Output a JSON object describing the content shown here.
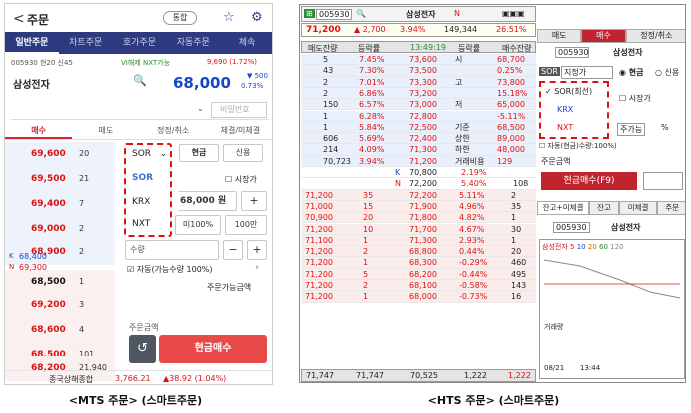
{
  "mts": {
    "back_glyph": "<",
    "title": "주문",
    "toggle_label": "통합",
    "tabs": [
      "일반주문",
      "차트주문",
      "호가주문",
      "자동주문",
      "체속"
    ],
    "info_left": "005930 현20 신45",
    "info_mid": "VI해제 NXT가능",
    "info_right": "9,690 (1.72%)",
    "stock_name": "삼성전자",
    "price": "68,000",
    "price_change": "▼ 500",
    "price_rate": "0.73%",
    "password_placeholder": "비밀번호",
    "order_tabs": [
      "매수",
      "매도",
      "정정/취소",
      "체결/미체결"
    ],
    "hoga": [
      {
        "price": "69,600",
        "qty": "20"
      },
      {
        "price": "69,500",
        "qty": "21"
      },
      {
        "price": "69,400",
        "qty": "7"
      },
      {
        "price": "69,000",
        "qty": "2"
      },
      {
        "price": "68,900",
        "qty": "2"
      },
      {
        "price": "68,500",
        "qty": "1"
      },
      {
        "price": "69,200",
        "qty": "3"
      },
      {
        "price": "68,600",
        "qty": "4"
      },
      {
        "price": "68,500",
        "qty": "101"
      },
      {
        "price": "68,200",
        "qty": "21,940"
      }
    ],
    "krx_price": "68,400",
    "nxt_price": "69,300",
    "route_selected": "SOR",
    "route_options": [
      "SOR",
      "KRX",
      "NXT"
    ],
    "cash_label": "현금",
    "credit_label": "신용",
    "market_price_label": "시장가",
    "order_price": "68,000 원",
    "btn_minus": "−",
    "btn_plus": "+",
    "btn_100": "미100%",
    "btn_100b": "100만",
    "qty_label": "수량",
    "auto_label": "자동(가능수량 100%)",
    "orderable_label": "주문가능금액",
    "order_amount_label": "주문금액",
    "refresh_glyph": "↺",
    "buy_button": "현금매수",
    "footer_label": "종국상해종합",
    "footer_value": "3,766.21",
    "footer_change": "▲38.92 (1.04%)"
  },
  "hts": {
    "code": "005930",
    "stock_name": "삼성전자",
    "price": "71,200",
    "change": "▲ 2,700",
    "rate": "3.94%",
    "volume": "149,344",
    "vol_rate": "26.51%",
    "header_cols": [
      "매도잔량",
      "등락률",
      "13:49:19",
      "등락률",
      "매수잔량"
    ],
    "ask_rows": [
      {
        "qty": "5",
        "rate": "7.45%",
        "price": "73,600",
        "note": "시",
        "right": "68,700"
      },
      {
        "qty": "43",
        "rate": "7.30%",
        "price": "73,500",
        "note": "",
        "right": "0.25%"
      },
      {
        "qty": "2",
        "rate": "7.01%",
        "price": "73,300",
        "note": "고",
        "right": "73,800"
      },
      {
        "qty": "2",
        "rate": "6.86%",
        "price": "73,200",
        "note": "",
        "right": "15.18%"
      },
      {
        "qty": "150",
        "rate": "6.57%",
        "price": "73,000",
        "note": "저",
        "right": "65,000"
      },
      {
        "qty": "1",
        "rate": "6.28%",
        "price": "72,800",
        "note": "",
        "right": "-5.11%"
      },
      {
        "qty": "1",
        "rate": "5.84%",
        "price": "72,500",
        "note": "기준",
        "right": "68,500"
      },
      {
        "qty": "606",
        "rate": "5.69%",
        "price": "72,400",
        "note": "상한",
        "right": "89,000"
      },
      {
        "qty": "214",
        "rate": "4.09%",
        "price": "71,300",
        "note": "하한",
        "right": "48,000"
      },
      {
        "qty": "70,723",
        "rate": "3.94%",
        "price": "71,200",
        "note": "거래비용",
        "right": "129"
      }
    ],
    "exch_rows": [
      {
        "tag": "K",
        "price": "70,800",
        "rate": "2.19%",
        "right": ""
      },
      {
        "tag": "N",
        "price": "72,200",
        "rate": "5.40%",
        "right": "108"
      }
    ],
    "bid_rows": [
      {
        "left": "71,200",
        "lq": "35",
        "price": "72,200",
        "rate": "5.11%",
        "qty": "2"
      },
      {
        "left": "71,000",
        "lq": "15",
        "price": "71,900",
        "rate": "4.96%",
        "qty": "35"
      },
      {
        "left": "70,900",
        "lq": "20",
        "price": "71,800",
        "rate": "4.82%",
        "qty": "1"
      },
      {
        "left": "71,200",
        "lq": "10",
        "price": "71,700",
        "rate": "4.67%",
        "qty": "30"
      },
      {
        "left": "71,100",
        "lq": "1",
        "price": "71,300",
        "rate": "2.93%",
        "qty": "1"
      },
      {
        "left": "71,200",
        "lq": "2",
        "price": "68,800",
        "rate": "0.44%",
        "qty": "20"
      },
      {
        "left": "71,200",
        "lq": "1",
        "price": "68,300",
        "rate": "-0.29%",
        "qty": "460"
      },
      {
        "left": "71,200",
        "lq": "5",
        "price": "68,200",
        "rate": "-0.44%",
        "qty": "495"
      },
      {
        "left": "71,200",
        "lq": "2",
        "price": "68,100",
        "rate": "-0.58%",
        "qty": "143"
      },
      {
        "left": "71,200",
        "lq": "1",
        "price": "68,000",
        "rate": "-0.73%",
        "qty": "16"
      }
    ],
    "foot": [
      "71,747",
      "71,747",
      "70,525",
      "1,222",
      "1,222"
    ],
    "rp_tabs": [
      "매도",
      "매수",
      "정정/취소"
    ],
    "rp_code": "005930",
    "rp_name": "삼성전자",
    "route_label": "SOR",
    "route_type": "지정가",
    "cash_label": "현금",
    "credit_label": "신용",
    "route_options": [
      "SOR(최선)",
      "KRX",
      "NXT"
    ],
    "market_label": "시장가",
    "order_possible": "주가능",
    "pct": "%",
    "auto_label": "자동(현금)수량:100%)",
    "order_amount_label": "주문금액",
    "buy_button": "현금매수(F9)",
    "bottom_tabs": [
      "잔고+미체결",
      "잔고",
      "미체결",
      "주문"
    ],
    "mini_code": "005930",
    "mini_name": "삼성전자",
    "ma_label": "삼성전자",
    "ma_values": [
      "5",
      "10",
      "20",
      "60",
      "120"
    ],
    "volume_label": "거래량",
    "time_labels": [
      "08/21",
      "13:44"
    ]
  },
  "labels": {
    "mts_caption": "<MTS 주문> (스마트주문)",
    "hts_caption": "<HTS 주문> (스마트주문)"
  }
}
